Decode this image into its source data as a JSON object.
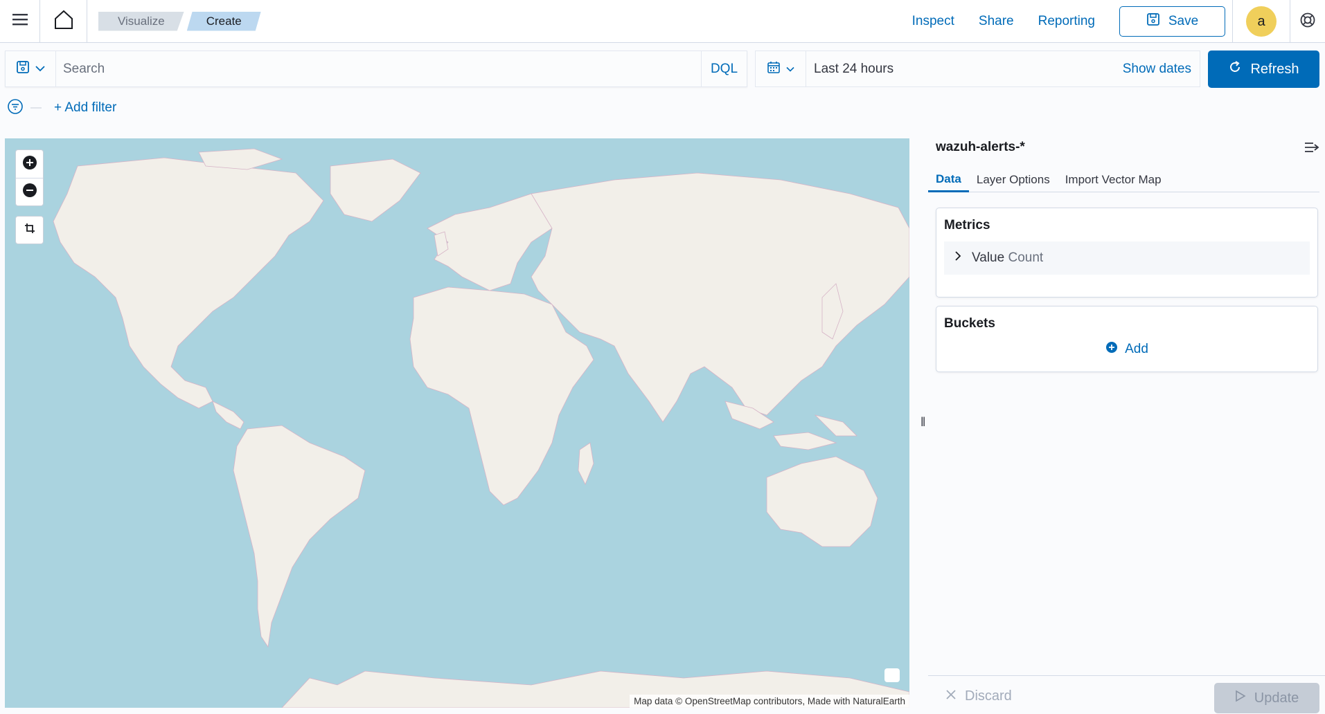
{
  "header": {
    "breadcrumbs": [
      "Visualize",
      "Create"
    ],
    "links": {
      "inspect": "Inspect",
      "share": "Share",
      "reporting": "Reporting"
    },
    "save_label": "Save",
    "avatar_initial": "a"
  },
  "query": {
    "search_placeholder": "Search",
    "language": "DQL",
    "time_range": "Last 24 hours",
    "show_dates": "Show dates",
    "refresh_label": "Refresh",
    "add_filter": "+ Add filter"
  },
  "map": {
    "attribution": "Map data © OpenStreetMap contributors, Made with NaturalEarth",
    "water_color": "#aad3df",
    "land_color": "#f2efe9"
  },
  "sidebar": {
    "index_pattern": "wazuh-alerts-*",
    "tabs": [
      "Data",
      "Layer Options",
      "Import Vector Map"
    ],
    "active_tab": "Data",
    "metrics": {
      "title": "Metrics",
      "item_label": "Value",
      "item_agg": "Count"
    },
    "buckets": {
      "title": "Buckets",
      "add_label": "Add"
    },
    "discard_label": "Discard",
    "update_label": "Update"
  },
  "colors": {
    "primary": "#006bb8",
    "avatar": "#f0cf5b"
  }
}
